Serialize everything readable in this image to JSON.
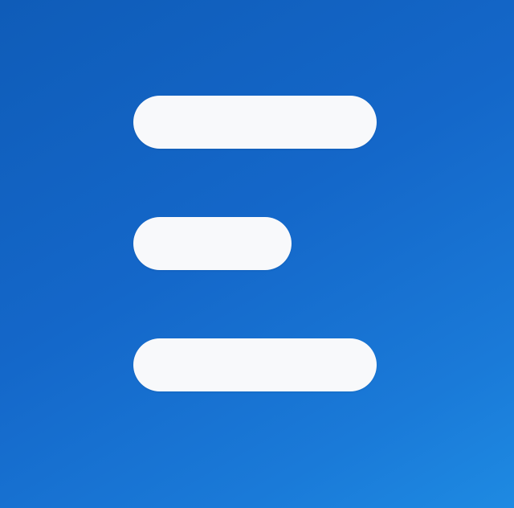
{
  "icon": {
    "name": "menu-icon",
    "background_color": "#1467c9",
    "glyph_color": "#f8f9fb"
  }
}
